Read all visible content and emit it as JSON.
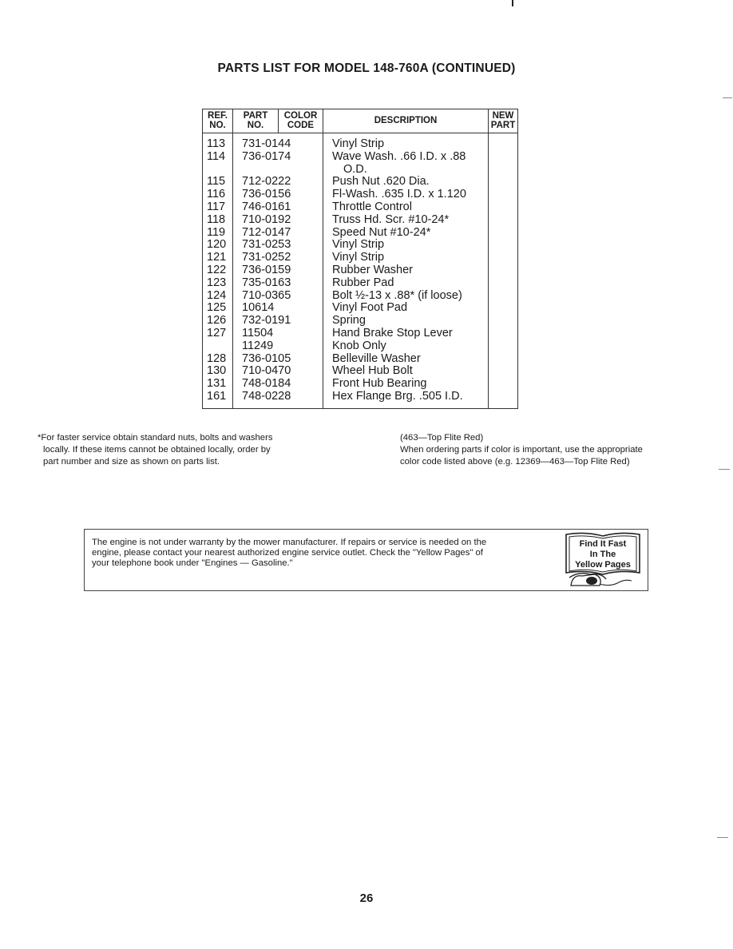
{
  "title": "PARTS LIST FOR MODEL 148-760A (CONTINUED)",
  "table": {
    "headers": {
      "ref": [
        "REF.",
        "NO."
      ],
      "part": [
        "PART",
        "NO."
      ],
      "color": [
        "COLOR",
        "CODE"
      ],
      "description": "DESCRIPTION",
      "new": [
        "NEW",
        "PART"
      ]
    },
    "rows": [
      {
        "ref": "113",
        "part": "731-0144",
        "description": "Vinyl Strip"
      },
      {
        "ref": "114",
        "part": "736-0174",
        "description": "Wave Wash. .66 I.D. x .88"
      },
      {
        "ref": "",
        "part": "",
        "description": "O.D.",
        "continuation": true
      },
      {
        "ref": "115",
        "part": "712-0222",
        "description": "Push Nut .620 Dia."
      },
      {
        "ref": "116",
        "part": "736-0156",
        "description": "Fl-Wash. .635 I.D. x 1.120"
      },
      {
        "ref": "117",
        "part": "746-0161",
        "description": "Throttle Control"
      },
      {
        "ref": "118",
        "part": "710-0192",
        "description": "Truss Hd. Scr. #10-24*"
      },
      {
        "ref": "119",
        "part": "712-0147",
        "description": "Speed Nut #10-24*"
      },
      {
        "ref": "120",
        "part": "731-0253",
        "description": "Vinyl Strip"
      },
      {
        "ref": "121",
        "part": "731-0252",
        "description": "Vinyl Strip"
      },
      {
        "ref": "122",
        "part": "736-0159",
        "description": "Rubber Washer"
      },
      {
        "ref": "123",
        "part": "735-0163",
        "description": "Rubber Pad"
      },
      {
        "ref": "124",
        "part": "710-0365",
        "description": "Bolt ½-13 x .88* (if loose)"
      },
      {
        "ref": "125",
        "part": "10614",
        "description": "Vinyl Foot Pad"
      },
      {
        "ref": "126",
        "part": "732-0191",
        "description": "Spring"
      },
      {
        "ref": "127",
        "part": "11504",
        "description": "Hand Brake Stop Lever"
      },
      {
        "ref": "",
        "part": "11249",
        "description": "Knob Only"
      },
      {
        "ref": "128",
        "part": "736-0105",
        "description": "Belleville Washer"
      },
      {
        "ref": "130",
        "part": "710-0470",
        "description": "Wheel Hub Bolt"
      },
      {
        "ref": "131",
        "part": "748-0184",
        "description": "Front Hub Bearing"
      },
      {
        "ref": "161",
        "part": "748-0228",
        "description": "Hex Flange Brg. .505 I.D."
      }
    ]
  },
  "footnote_left": [
    "*For faster service obtain standard nuts, bolts and washers",
    "locally. If these items cannot be obtained locally, order by",
    "part number and size as shown on parts list."
  ],
  "footnote_right": [
    "(463—Top Flite Red)",
    "When ordering parts if color is important, use the appropriate",
    "color code listed above (e.g. 12369—463—Top Flite Red)"
  ],
  "warranty": {
    "lines": [
      "The engine is not under warranty by the mower manufacturer. If repairs or service is needed on the",
      "engine, please contact your nearest authorized engine service outlet. Check the \"Yellow Pages\" of",
      "your telephone book under \"Engines — Gasoline.\""
    ],
    "badge": [
      "Find It Fast",
      "In The",
      "Yellow Pages"
    ]
  },
  "page_number": "26"
}
